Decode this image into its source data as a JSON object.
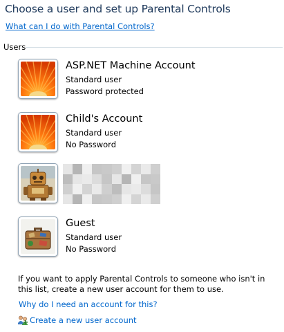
{
  "page": {
    "title": "Choose a user and set up Parental Controls",
    "help_link": "What can I do with Parental Controls?",
    "section_label": "Users"
  },
  "users": [
    {
      "name": "ASP.NET Machine Account",
      "role": "Standard user",
      "password": "Password protected",
      "icon": "orange-flower-avatar"
    },
    {
      "name": "Child's Account",
      "role": "Standard user",
      "password": "No Password",
      "icon": "orange-flower-avatar"
    },
    {
      "name": "",
      "role": "",
      "password": "",
      "icon": "robot-avatar",
      "redacted": true
    },
    {
      "name": "Guest",
      "role": "Standard user",
      "password": "No Password",
      "icon": "suitcase-avatar"
    }
  ],
  "footer": {
    "info_text": "If you want to apply Parental Controls to someone who isn't in this list, create a new user account for them to use.",
    "why_link": "Why do I need an account for this?",
    "create_link": "Create a new user account",
    "create_icon": "users-icon"
  },
  "colors": {
    "title": "#1e395b",
    "link": "#0066cc"
  }
}
